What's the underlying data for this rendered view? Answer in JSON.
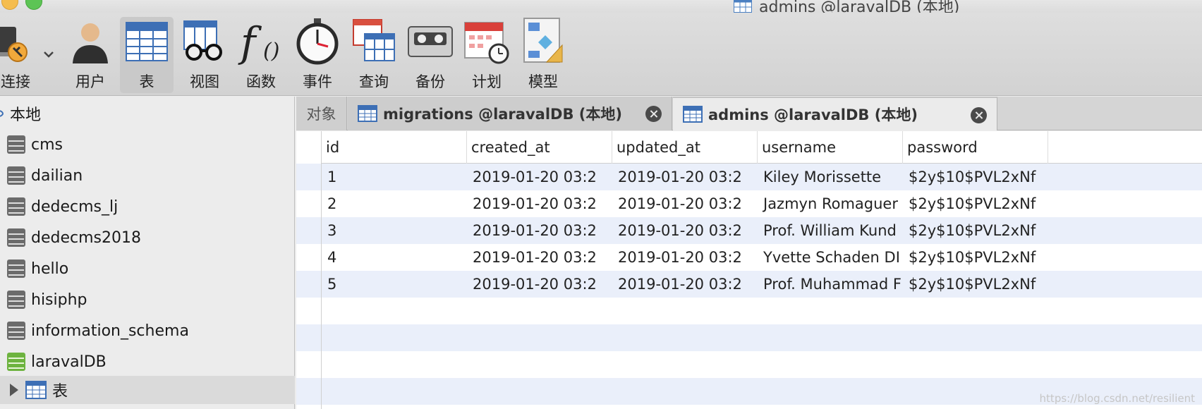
{
  "window": {
    "title": "admins @laravalDB (本地)"
  },
  "toolbar": {
    "items": [
      {
        "label": "连接",
        "icon": "connection-icon"
      },
      {
        "label": "用户",
        "icon": "user-icon"
      },
      {
        "label": "表",
        "icon": "table-icon",
        "active": true
      },
      {
        "label": "视图",
        "icon": "view-icon"
      },
      {
        "label": "函数",
        "icon": "function-icon"
      },
      {
        "label": "事件",
        "icon": "stopwatch-icon"
      },
      {
        "label": "查询",
        "icon": "query-icon"
      },
      {
        "label": "备份",
        "icon": "backup-icon"
      },
      {
        "label": "计划",
        "icon": "calendar-icon"
      },
      {
        "label": "模型",
        "icon": "model-icon"
      }
    ]
  },
  "sidebar": {
    "connection": "本地",
    "databases": [
      "cms",
      "dailian",
      "dedecms_lj",
      "dedecms2018",
      "hello",
      "hisiphp",
      "information_schema",
      "laravalDB"
    ],
    "open_db_child": "表"
  },
  "tabs": {
    "objects": "对象",
    "items": [
      {
        "label": "migrations @laravalDB (本地)"
      },
      {
        "label": "admins @laravalDB (本地)",
        "active": true
      }
    ]
  },
  "table": {
    "columns": [
      "id",
      "created_at",
      "updated_at",
      "username",
      "password"
    ],
    "rows": [
      [
        "1",
        "2019-01-20 03:2",
        "2019-01-20 03:2",
        "Kiley Morissette",
        "$2y$10$PVL2xNf"
      ],
      [
        "2",
        "2019-01-20 03:2",
        "2019-01-20 03:2",
        "Jazmyn Romaguer",
        "$2y$10$PVL2xNf"
      ],
      [
        "3",
        "2019-01-20 03:2",
        "2019-01-20 03:2",
        "Prof. William Kund",
        "$2y$10$PVL2xNf"
      ],
      [
        "4",
        "2019-01-20 03:2",
        "2019-01-20 03:2",
        "Yvette Schaden DI",
        "$2y$10$PVL2xNf"
      ],
      [
        "5",
        "2019-01-20 03:2",
        "2019-01-20 03:2",
        "Prof. Muhammad F",
        "$2y$10$PVL2xNf"
      ]
    ]
  },
  "watermark": "https://blog.csdn.net/resilient",
  "colors": {
    "stripe": "#eaeffa",
    "db_green": "#6db33f",
    "db_gray": "#6b6b6b"
  }
}
